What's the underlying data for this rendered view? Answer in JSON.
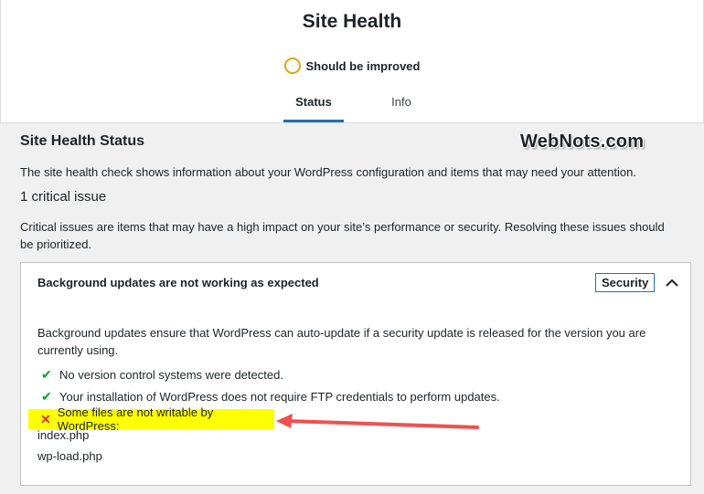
{
  "header": {
    "title": "Site Health",
    "status_text": "Should be improved",
    "tabs": [
      {
        "label": "Status",
        "active": true
      },
      {
        "label": "Info",
        "active": false
      }
    ]
  },
  "watermark": "WebNots.com",
  "main": {
    "section_title": "Site Health Status",
    "description": "The site health check shows information about your WordPress configuration and items that may need your attention.",
    "critical_count": "1 critical issue",
    "critical_description": "Critical issues are items that may have a high impact on your site’s performance or security. Resolving these issues should be prioritized."
  },
  "panel": {
    "title": "Background updates are not working as expected",
    "badge": "Security",
    "description": "Background updates ensure that WordPress can auto-update if a security update is released for the version you are currently using.",
    "checks": [
      {
        "icon": "check-icon",
        "text": "No version control systems were detected."
      },
      {
        "icon": "check-icon",
        "text": "Your installation of WordPress does not require FTP credentials to perform updates."
      }
    ],
    "error": {
      "icon": "x-icon",
      "text": "Some files are not writable by WordPress:"
    },
    "files": [
      "index.php",
      "wp-load.php"
    ]
  },
  "colors": {
    "accent": "#2271b1",
    "warning": "#dba617",
    "success": "#00a32a",
    "error": "#d63638",
    "highlight": "#ffff00",
    "arrow": "#f05050"
  }
}
